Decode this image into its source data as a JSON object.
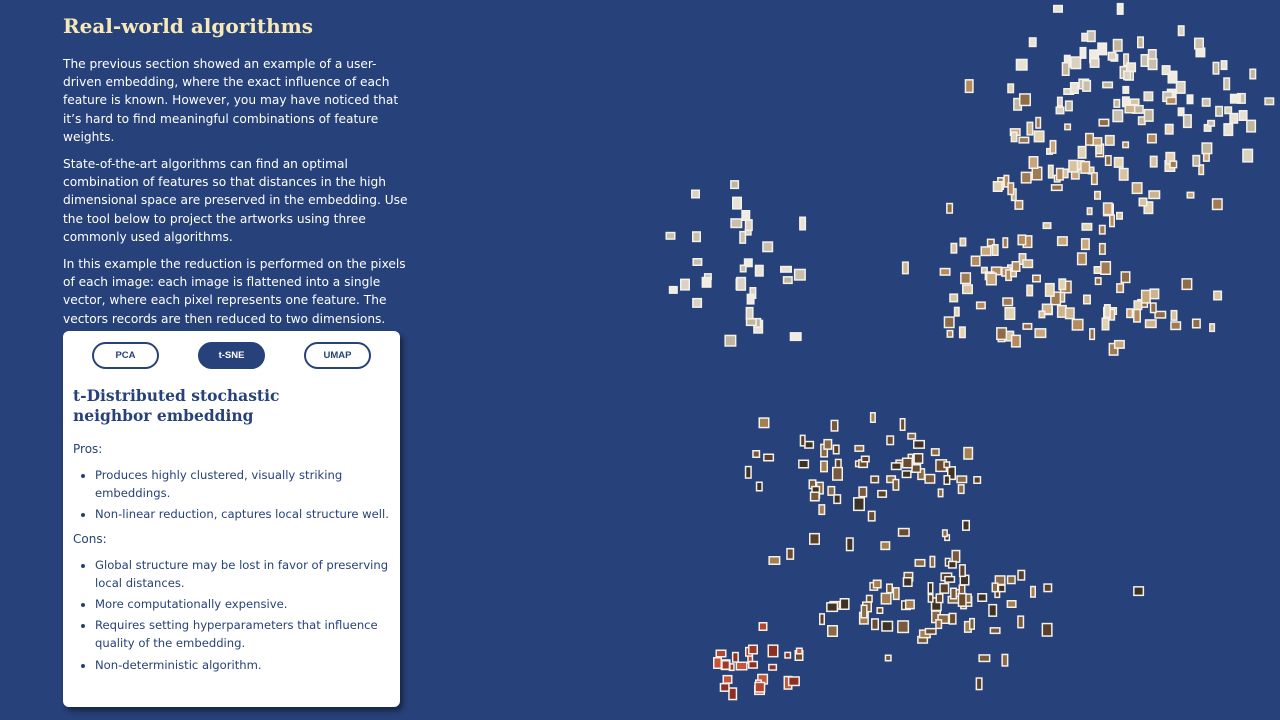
{
  "section": {
    "title": "Real-world algorithms",
    "paragraphs": [
      "The previous section showed an example of a user-driven embedding, where the exact influence of each feature is known. However, you may have noticed that it’s hard to find meaningful combinations of feature weights.",
      "State-of-the-art algorithms can find an optimal combination of features so that distances in the high dimensional space are preserved in the embedding. Use the tool below to project the artworks using three commonly used algorithms.",
      "In this example the reduction is performed on the pixels of each image: each image is flattened into a single vector, where each pixel represents one feature. The vectors records are then reduced to two dimensions."
    ]
  },
  "card": {
    "buttons": [
      {
        "label": "PCA",
        "active": false
      },
      {
        "label": "t-SNE",
        "active": true
      },
      {
        "label": "UMAP",
        "active": false
      }
    ],
    "algo_title": "t-Distributed stochastic neighbor embedding",
    "pros_label": "Pros:",
    "pros": [
      "Produces highly clustered, visually striking embeddings.",
      "Non-linear reduction, captures local structure well."
    ],
    "cons_label": "Cons:",
    "cons": [
      "Global structure may be lost in favor of preserving local distances.",
      "More computationally expensive.",
      "Requires setting hyperparameters that influence quality of the embedding.",
      "Non-deterministic algorithm."
    ]
  },
  "colors": {
    "background": "#27427a",
    "title": "#f7e9b7",
    "card": "#ffffff",
    "accent": "#27427a"
  },
  "embedding": {
    "algorithm": "t-SNE",
    "item_type": "artwork-thumbnail"
  }
}
